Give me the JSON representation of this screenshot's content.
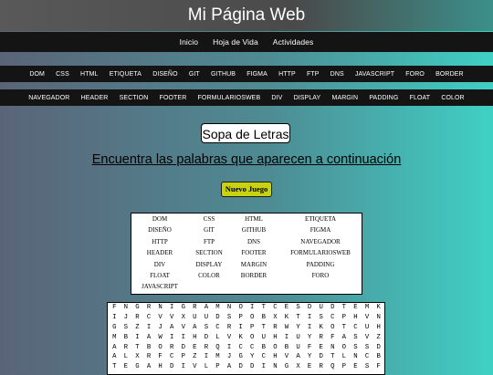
{
  "header": {
    "title": "Mi Página Web"
  },
  "main_nav": [
    "Inicio",
    "Hoja de Vida",
    "Actividades"
  ],
  "topics_row1": [
    "DOM",
    "CSS",
    "HTML",
    "ETIQUETA",
    "DISEÑO",
    "GIT",
    "GITHUB",
    "FIGMA",
    "HTTP",
    "FTP",
    "DNS",
    "JAVASCRIPT",
    "FORO",
    "BORDER"
  ],
  "topics_row2": [
    "NAVEGADOR",
    "HEADER",
    "SECTION",
    "FOOTER",
    "FORMULARIOSWEB",
    "DIV",
    "DISPLAY",
    "MARGIN",
    "PADDING",
    "FLOAT",
    "COLOR"
  ],
  "game": {
    "title": "Sopa de Letras",
    "subtitle": "Encuentra las palabras que aparecen a continuación",
    "new_game_label": "Nuevo Juego"
  },
  "word_list": [
    "DOM",
    "CSS",
    "HTML",
    "ETIQUETA",
    "DISEÑO",
    "GIT",
    "GITHUB",
    "FIGMA",
    "HTTP",
    "FTP",
    "DNS",
    "NAVEGADOR",
    "HEADER",
    "SECTION",
    "FOOTER",
    "FORMULARIOSWEB",
    "DIV",
    "DISPLAY",
    "MARGIN",
    "PADDING",
    "FLOAT",
    "COLOR",
    "BORDER",
    "FORO",
    "JAVASCRIPT"
  ],
  "letter_grid": [
    [
      "F",
      "N",
      "G",
      "R",
      "N",
      "I",
      "G",
      "R",
      "A",
      "M",
      "N",
      "O",
      "I",
      "T",
      "C",
      "E",
      "S",
      "D",
      "U",
      "D",
      "T",
      "E",
      "M",
      "K"
    ],
    [
      "I",
      "J",
      "R",
      "C",
      "V",
      "V",
      "X",
      "U",
      "U",
      "D",
      "S",
      "P",
      "O",
      "B",
      "X",
      "K",
      "T",
      "I",
      "S",
      "C",
      "P",
      "H",
      "V",
      "N"
    ],
    [
      "G",
      "S",
      "Z",
      "I",
      "J",
      "A",
      "V",
      "A",
      "S",
      "C",
      "R",
      "I",
      "P",
      "T",
      "R",
      "W",
      "Y",
      "I",
      "K",
      "O",
      "T",
      "C",
      "U",
      "H"
    ],
    [
      "M",
      "B",
      "I",
      "A",
      "W",
      "I",
      "I",
      "H",
      "D",
      "L",
      "V",
      "K",
      "O",
      "U",
      "H",
      "I",
      "U",
      "Y",
      "R",
      "F",
      "A",
      "S",
      "V",
      "Z"
    ],
    [
      "A",
      "R",
      "T",
      "B",
      "O",
      "R",
      "D",
      "E",
      "R",
      "Q",
      "I",
      "C",
      "C",
      "B",
      "O",
      "B",
      "U",
      "F",
      "E",
      "N",
      "O",
      "S",
      "S",
      "D"
    ],
    [
      "A",
      "L",
      "X",
      "R",
      "F",
      "C",
      "P",
      "Z",
      "I",
      "M",
      "J",
      "G",
      "Y",
      "C",
      "H",
      "V",
      "A",
      "Y",
      "D",
      "T",
      "L",
      "N",
      "C",
      "B"
    ],
    [
      "T",
      "E",
      "G",
      "A",
      "H",
      "D",
      "I",
      "V",
      "L",
      "P",
      "A",
      "D",
      "D",
      "I",
      "N",
      "G",
      "X",
      "E",
      "R",
      "Q",
      "P",
      "E",
      "S",
      "F"
    ]
  ]
}
